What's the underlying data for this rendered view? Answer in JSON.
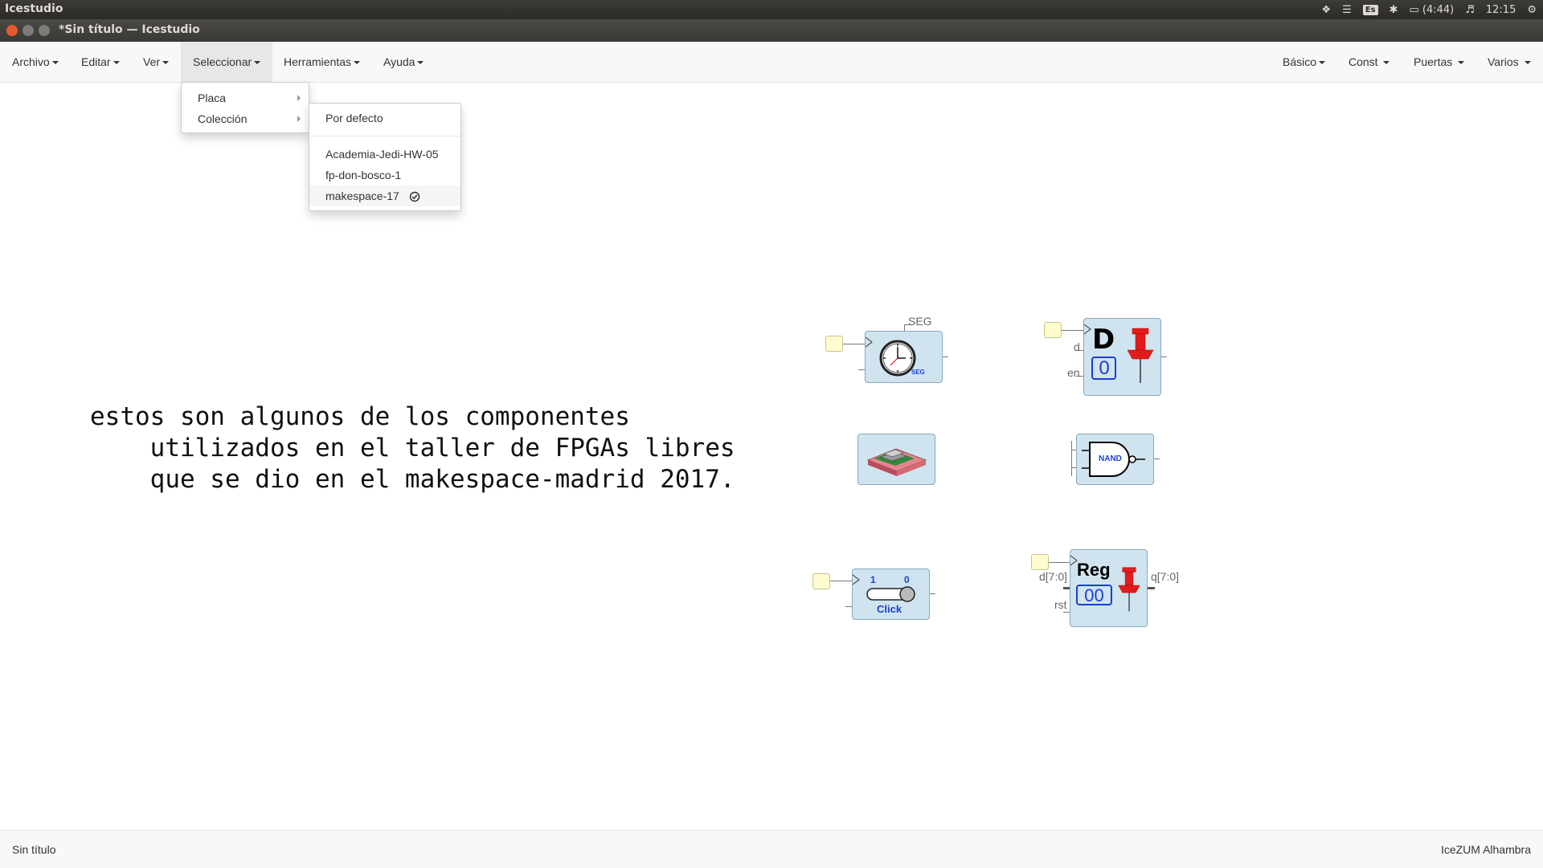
{
  "os_panel": {
    "app_name": "Icestudio",
    "battery": "(4:44)",
    "time": "12:15",
    "keyboard_layout": "Es"
  },
  "window": {
    "title": "*Sin título — Icestudio"
  },
  "menubar": {
    "left": [
      "Archivo",
      "Editar",
      "Ver",
      "Seleccionar",
      "Herramientas",
      "Ayuda"
    ],
    "right": [
      "Básico",
      "Const",
      "Puertas",
      "Varios"
    ],
    "active": "Seleccionar"
  },
  "seleccionar_menu": {
    "items": [
      "Placa",
      "Colección"
    ]
  },
  "coleccion_submenu": {
    "default": "Por defecto",
    "items": [
      "Academia-Jedi-HW-05",
      "fp-don-bosco-1",
      "makespace-17"
    ],
    "selected": "makespace-17"
  },
  "canvas": {
    "comment_lines": [
      "estos son algunos de los componentes",
      "    utilizados en el taller de FPGAs libres",
      "    que se dio en el makespace-madrid 2017."
    ],
    "blocks": {
      "timer": {
        "label": "SEG",
        "icon_text": "SEG"
      },
      "dff": {
        "title": "D",
        "value": "0",
        "port_d": "d",
        "port_en": "en"
      },
      "nand": {
        "text": "NAND"
      },
      "button": {
        "left": "1",
        "right": "0",
        "text": "Click"
      },
      "reg": {
        "title": "Reg",
        "value": "00",
        "port_in": "d[7:0]",
        "port_out": "q[7:0]",
        "port_rst": "rst"
      }
    }
  },
  "statusbar": {
    "left": "Sin título",
    "right": "IceZUM Alhambra"
  },
  "colors": {
    "block_fill": "#cfe4ef",
    "pin_fill": "#fffccf",
    "pushpin": "#e21b1b",
    "accent_blue": "#1a3fd0"
  }
}
